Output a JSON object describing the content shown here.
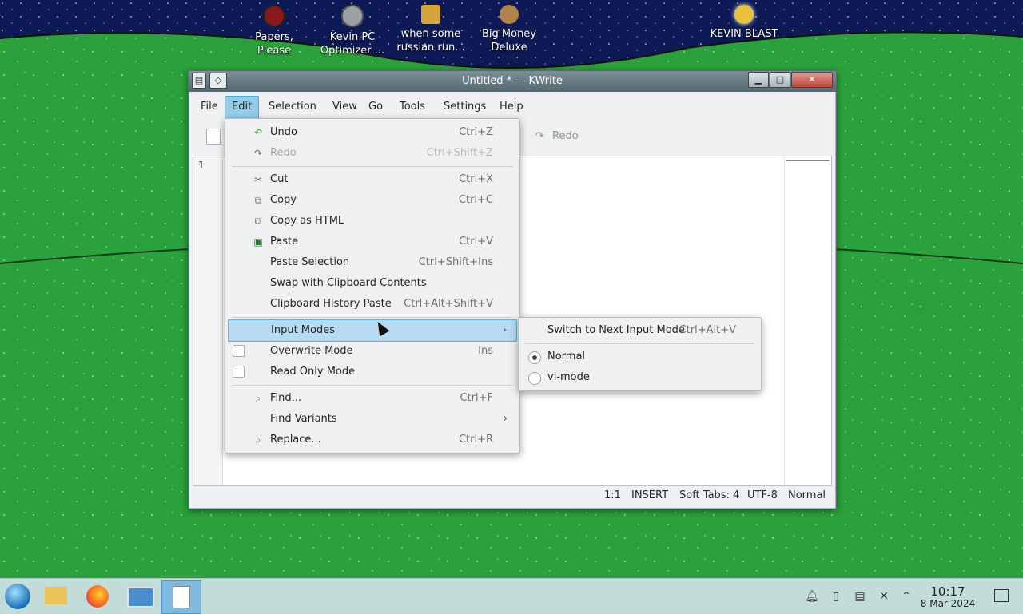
{
  "desktop": {
    "icons": [
      {
        "label": "Papers,\nPlease",
        "icon": "papers-please-icon",
        "color": "#8a1a1a"
      },
      {
        "label": "Kevin PC\nOptimizer ...",
        "icon": "optimizer-icon",
        "color": "#9aa0a4"
      },
      {
        "label": "when some\nrussian run...",
        "icon": "crown-icon",
        "color": "#d4a63a"
      },
      {
        "label": "Big Money\nDeluxe",
        "icon": "money-bag-icon",
        "color": "#b3824a"
      },
      {
        "label": "KEVIN BLAST",
        "icon": "blast-icon",
        "color": "#e8c23a"
      }
    ]
  },
  "window": {
    "title": "Untitled * — KWrite",
    "menubar": [
      "File",
      "Edit",
      "Selection",
      "View",
      "Go",
      "Tools",
      "Settings",
      "Help"
    ],
    "active_menu": "Edit",
    "toolbar": {
      "redo_label": "Redo"
    },
    "editor": {
      "line_number": "1"
    },
    "statusbar": {
      "position": "1:1",
      "mode": "INSERT",
      "tabs": "Soft Tabs: 4",
      "encoding": "UTF-8",
      "input_mode": "Normal"
    }
  },
  "edit_menu": {
    "items": [
      {
        "label": "Undo",
        "shortcut": "Ctrl+Z",
        "icon": "undo-icon"
      },
      {
        "label": "Redo",
        "shortcut": "Ctrl+Shift+Z",
        "icon": "redo-icon",
        "disabled": true
      },
      {
        "label": "Cut",
        "shortcut": "Ctrl+X",
        "icon": "cut-icon"
      },
      {
        "label": "Copy",
        "shortcut": "Ctrl+C",
        "icon": "copy-icon"
      },
      {
        "label": "Copy as HTML",
        "shortcut": "",
        "icon": "copy-html-icon"
      },
      {
        "label": "Paste",
        "shortcut": "Ctrl+V",
        "icon": "paste-icon"
      },
      {
        "label": "Paste Selection",
        "shortcut": "Ctrl+Shift+Ins"
      },
      {
        "label": "Swap with Clipboard Contents",
        "shortcut": ""
      },
      {
        "label": "Clipboard History Paste",
        "shortcut": "Ctrl+Alt+Shift+V"
      },
      {
        "label": "Input Modes",
        "shortcut": "",
        "submenu": true,
        "highlighted": true
      },
      {
        "label": "Overwrite Mode",
        "shortcut": "Ins",
        "checkbox": true,
        "checked": false
      },
      {
        "label": "Read Only Mode",
        "shortcut": "",
        "checkbox": true,
        "checked": false
      },
      {
        "label": "Find...",
        "shortcut": "Ctrl+F",
        "icon": "find-icon"
      },
      {
        "label": "Find Variants",
        "shortcut": "",
        "submenu": true
      },
      {
        "label": "Replace...",
        "shortcut": "Ctrl+R",
        "icon": "replace-icon"
      }
    ]
  },
  "input_modes_menu": {
    "switch_label": "Switch to Next Input Mode",
    "switch_shortcut": "Ctrl+Alt+V",
    "options": [
      {
        "label": "Normal",
        "selected": true
      },
      {
        "label": "vi-mode",
        "selected": false
      }
    ]
  },
  "taskbar": {
    "apps": [
      "start-orb-icon",
      "file-manager-icon",
      "firefox-icon",
      "system-settings-icon",
      "kwrite-icon"
    ],
    "tray": [
      "notifications-icon",
      "clipboard-manager-icon",
      "clipboard-icon",
      "volume-muted-icon",
      "tray-expand-icon"
    ],
    "clock": {
      "time": "10:17",
      "date": "8 Mar 2024"
    }
  },
  "colors": {
    "accent": "#3daee9",
    "desktop_green": "#2aa13a",
    "sky": "#0d1a55"
  }
}
